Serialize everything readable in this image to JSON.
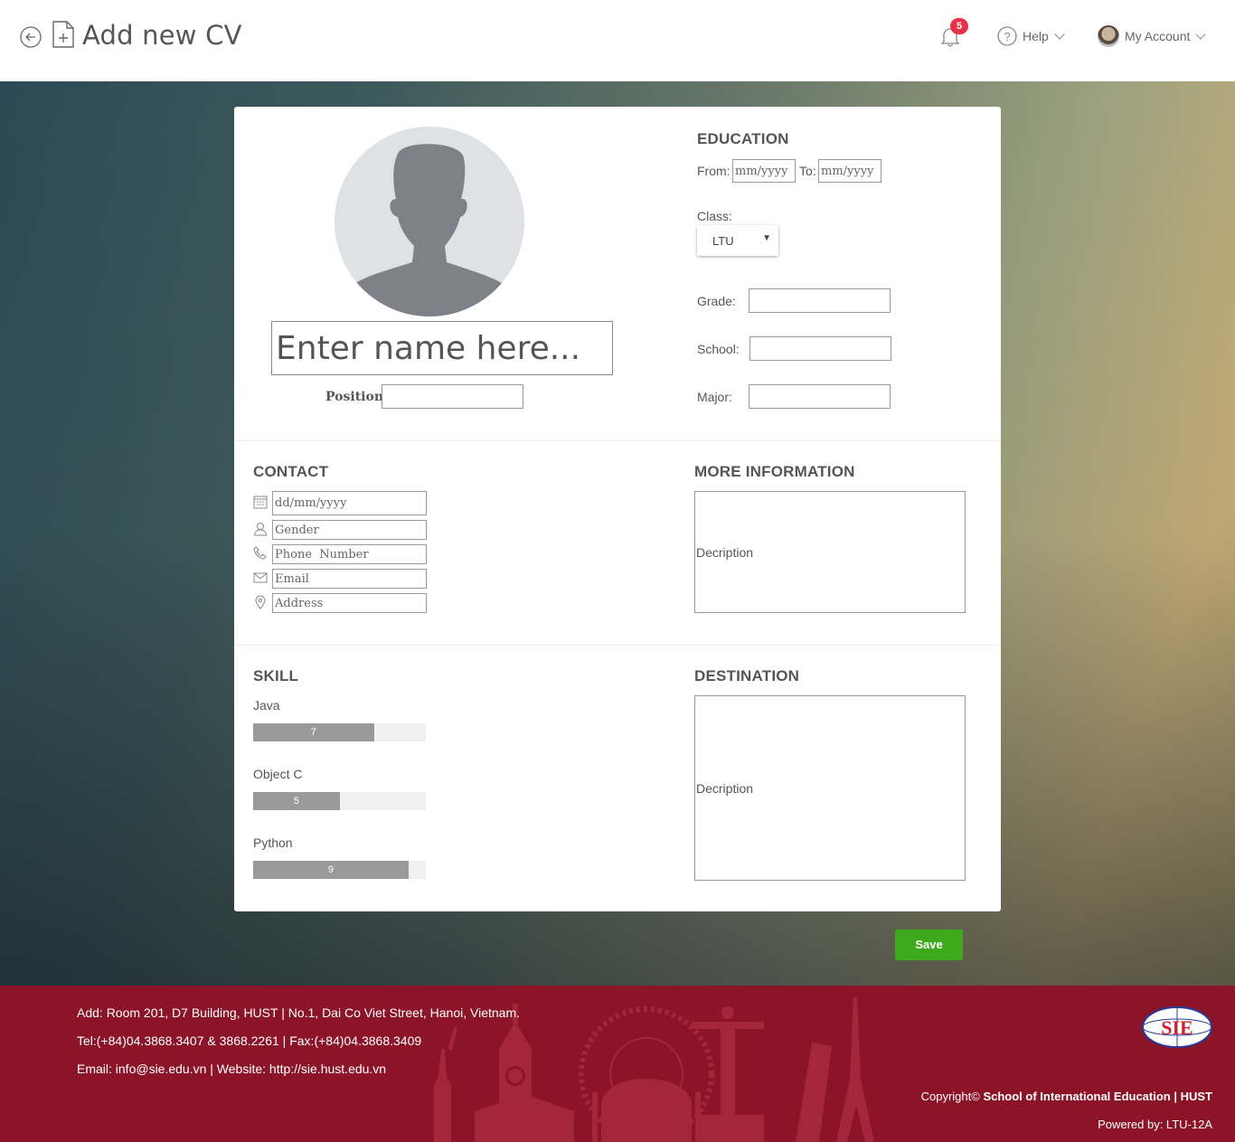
{
  "header": {
    "title": "Add new CV",
    "notifications_count": "5",
    "help_label": "Help",
    "account_label": "My Account"
  },
  "profile": {
    "name_placeholder": "Enter name here...",
    "position_label": "Position:"
  },
  "education": {
    "heading": "EDUCATION",
    "from_label": "From:",
    "to_label": "To:",
    "date_placeholder": "mm/yyyy",
    "class_label": "Class:",
    "class_value": "LTU",
    "grade_label": "Grade:",
    "school_label": "School:",
    "major_label": "Major:"
  },
  "contact": {
    "heading": "CONTACT",
    "dob_placeholder": "dd/mm/yyyy",
    "gender_placeholder": "Gender",
    "phone_placeholder": "Phone  Number",
    "email_placeholder": "Email",
    "address_placeholder": "Address"
  },
  "more_info": {
    "heading": "MORE INFORMATION",
    "placeholder": "Decription"
  },
  "skill": {
    "heading": "SKILL",
    "items": [
      {
        "name": "Java",
        "value": "7",
        "level": 0.7
      },
      {
        "name": "Object C",
        "value": "5",
        "level": 0.5
      },
      {
        "name": "Python",
        "value": "9",
        "level": 0.9
      }
    ]
  },
  "destination": {
    "heading": "DESTINATION",
    "placeholder": "Decription"
  },
  "actions": {
    "save_label": "Save"
  },
  "footer": {
    "address": "Add: Room 201, D7 Building, HUST | No.1, Dai Co Viet Street, Hanoi, Vietnam.",
    "tel": "Tel:(+84)04.3868.3407 & 3868.2261 | Fax:(+84)04.3868.3409",
    "email_web": "Email: info@sie.edu.vn | Website: http://sie.hust.edu.vn",
    "copyright_prefix": "Copyright©",
    "copyright_org": "School of International Education | HUST",
    "powered": "Powered by: LTU-12A",
    "logo_text": "SIE"
  },
  "colors": {
    "accent_save": "#3daa1e",
    "footer_bg": "#8b1428",
    "badge": "#e8304a"
  }
}
